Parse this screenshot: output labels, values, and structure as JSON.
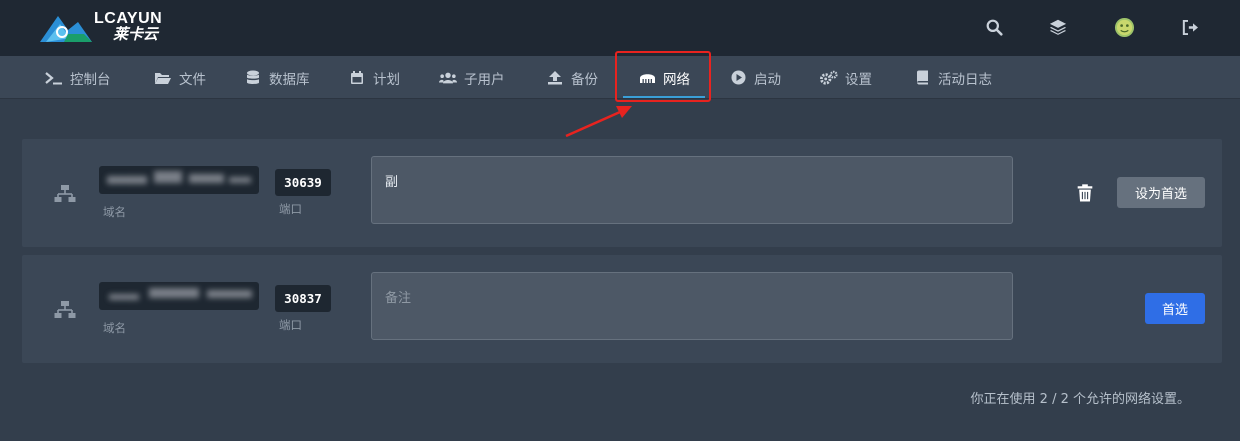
{
  "brand": {
    "name": "LCAYUN",
    "subtitle": "莱卡云"
  },
  "header": {
    "icons": [
      "search-icon",
      "layers-icon",
      "avatar",
      "logout-icon"
    ]
  },
  "nav": {
    "items": [
      {
        "label": "控制台",
        "icon": "terminal-icon"
      },
      {
        "label": "文件",
        "icon": "folder-icon"
      },
      {
        "label": "数据库",
        "icon": "database-icon"
      },
      {
        "label": "计划",
        "icon": "calendar-icon"
      },
      {
        "label": "子用户",
        "icon": "users-icon"
      },
      {
        "label": "备份",
        "icon": "upload-icon"
      },
      {
        "label": "网络",
        "icon": "network-icon",
        "active": true
      },
      {
        "label": "启动",
        "icon": "play-icon"
      },
      {
        "label": "设置",
        "icon": "cogs-icon"
      },
      {
        "label": "活动日志",
        "icon": "book-icon"
      }
    ]
  },
  "allocations": [
    {
      "domain_label": "域名",
      "port": "30639",
      "port_label": "端口",
      "note": "副",
      "is_primary": false,
      "action_label": "设为首选"
    },
    {
      "domain_label": "域名",
      "port": "30837",
      "port_label": "端口",
      "note": "",
      "note_placeholder": "备注",
      "is_primary": true,
      "action_label": "首选"
    }
  ],
  "footer": {
    "usage_text": "你正在使用 2 / 2 个允许的网络设置。"
  },
  "colors": {
    "header_bg": "#1f2833",
    "nav_bg": "#3b4756",
    "page_bg": "#333e4c",
    "accent": "#3aa0d8",
    "primary_button": "#2f6ee6",
    "highlight": "#e8231f"
  }
}
